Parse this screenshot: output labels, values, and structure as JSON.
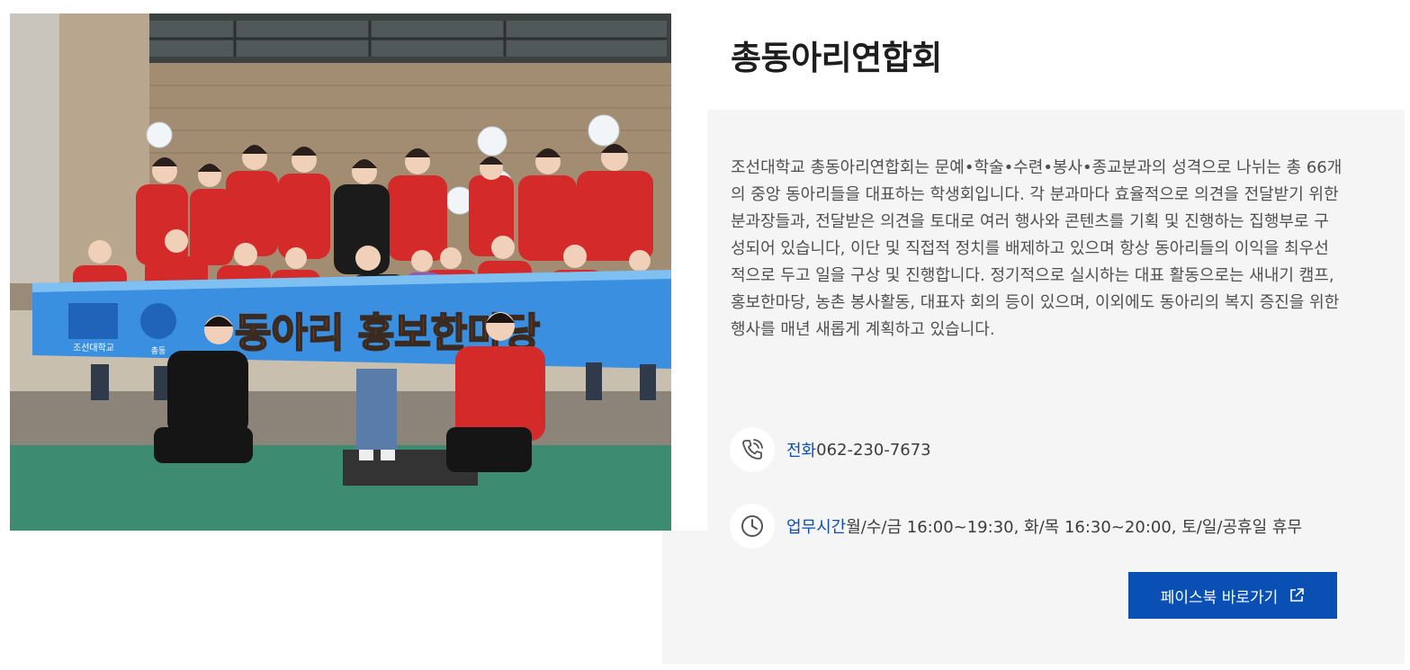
{
  "org": {
    "title": "총동아리연합회",
    "description": "조선대학교 총동아리연합회는 문예•학술•수련•봉사•종교분과의 성격으로 나뉘는 총 66개의 중앙 동아리들을 대표하는 학생회입니다. 각 분과마다 효율적으로 의견을 전달받기 위한 분과장들과, 전달받은 의견을 토대로 여러 행사와 콘텐츠를 기획 및 진행하는 집행부로 구성되어 있습니다, 이단 및 직접적 정치를 배제하고 있으며 항상 동아리들의 이익을 최우선적으로 두고 일을 구상 및 진행합니다. 정기적으로 실시하는 대표 활동으로는 새내기 캠프, 홍보한마당, 농촌 봉사활동, 대표자 회의 등이 있으며, 이외에도 동아리의 복지 증진을 위한 행사를 매년 새롭게 계획하고 있습니다."
  },
  "contact": {
    "phone_label": "전화",
    "phone_value": "062-230-7673",
    "hours_label": "업무시간",
    "hours_value": "월/수/금 16:00~19:30, 화/목 16:30~20:00, 토/일/공휴일 휴무"
  },
  "button": {
    "facebook_label": "페이스북 바로가기"
  },
  "photo": {
    "banner_text": "동아리 홍보한마당",
    "logo_text": "조선대학교",
    "logo_sub": "총동"
  },
  "colors": {
    "accent": "#0a50b4",
    "label_blue": "#0c4fb6",
    "panel_bg": "#f5f5f5",
    "jacket_red": "#d42a2a",
    "banner_blue": "#3b8fe0"
  },
  "icons": {
    "phone": "phone-ringing-icon",
    "clock": "clock-icon",
    "external": "external-link-icon"
  }
}
